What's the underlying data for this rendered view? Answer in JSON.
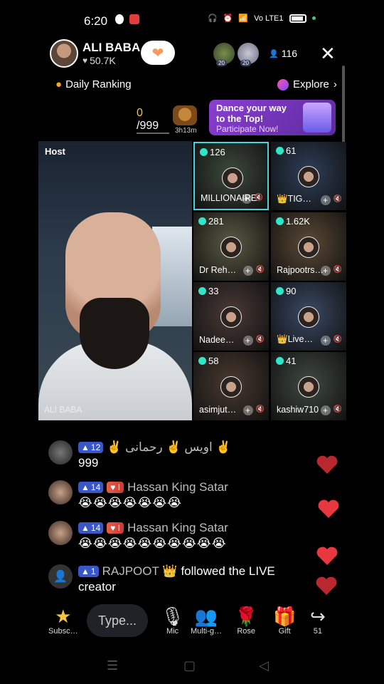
{
  "status_bar": {
    "time": "6:20",
    "signal_label": "Vo LTE1"
  },
  "header": {
    "host_name": "ALI BABA",
    "likes": "50.7K",
    "badge_a_level": "20",
    "badge_b_level": "20",
    "viewer_count": "116",
    "close_icon": "close-icon"
  },
  "ranking": {
    "label": "Daily Ranking",
    "explore": "Explore"
  },
  "score": {
    "current": "0",
    "total": "/999",
    "timer": "3h13m"
  },
  "promo": {
    "title_line1": "Dance your way",
    "title_line2": "to the Top!",
    "subtitle": "Participate Now!"
  },
  "host_tile": {
    "label": "Host",
    "name": "ALI BABA"
  },
  "guests": [
    {
      "count": "126",
      "name": "MILLIONAIRE",
      "color": "#3e4a3c"
    },
    {
      "count": "61",
      "name": "👑TIG…",
      "color": "#2e3e58"
    },
    {
      "count": "281",
      "name": "Dr Reh…",
      "color": "#5b5a44"
    },
    {
      "count": "1.62K",
      "name": "Rajpootrs…",
      "color": "#5c4a36"
    },
    {
      "count": "33",
      "name": "Nadee…",
      "color": "#4a3a36"
    },
    {
      "count": "90",
      "name": "👑Live…",
      "color": "#3a4a66"
    },
    {
      "count": "58",
      "name": "asimjut…",
      "color": "#4a3a30"
    },
    {
      "count": "41",
      "name": "kashiw710",
      "color": "#3f4a40"
    }
  ],
  "chat": [
    {
      "level": "12",
      "name": "✌️ اویس ✌️ رحمانی ✌️",
      "text": "999",
      "fan": ""
    },
    {
      "level": "14",
      "name": "Hassan King Satar",
      "text": "😭😭😭😭😭😭😭",
      "fan": "I"
    },
    {
      "level": "14",
      "name": "Hassan King Satar",
      "text": "😭😭😭😭😭😭😭😭😭😭",
      "fan": "I"
    },
    {
      "level": "1",
      "name": "RAJPOOT 👑",
      "text": "creator",
      "follow_text": "followed the LIVE"
    }
  ],
  "bottom_bar": {
    "subscribe": "Subsc…",
    "type_placeholder": "Type...",
    "mic": "Mic",
    "multi": "Multi-g…",
    "rose": "Rose",
    "gift": "Gift",
    "share_count": "51"
  }
}
